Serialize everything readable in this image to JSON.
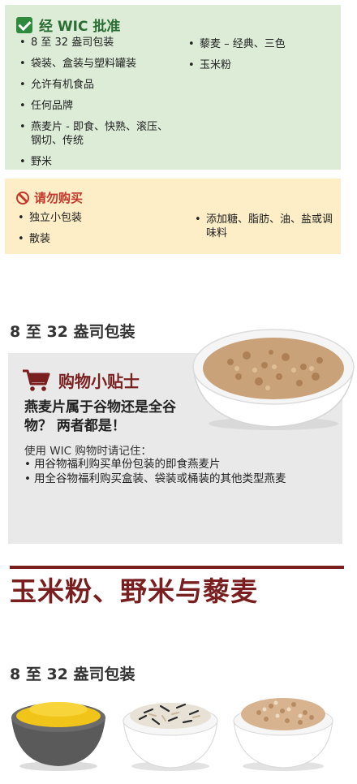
{
  "approved": {
    "title": "经 WIC 批准",
    "col1": [
      "8 至 32 盎司包装",
      "袋装、盒装与塑料罐装",
      "允许有机食品",
      "任何品牌",
      "燕麦片 - 即食、快熟、滚压、钢切、传统",
      "野米"
    ],
    "col2": [
      "藜麦 – 经典、三色",
      "玉米粉"
    ]
  },
  "not_buy": {
    "title": "请勿购买",
    "col1": [
      "独立小包装",
      "散装"
    ],
    "col2": [
      "添加糖、脂肪、油、盐或调味料"
    ]
  },
  "oats_section": {
    "size": "8 至 32 盎司包装"
  },
  "tips": {
    "title": "购物小贴士",
    "question": "燕麦片属于谷物还是全谷物？ 两者都是！",
    "intro": "使用 WIC 购物时请记住：",
    "items": [
      "用谷物福利购买单份包装的即食燕麦片",
      "用全谷物福利购买盒装、袋装或桶装的其他类型燕麦"
    ]
  },
  "cornmeal_section": {
    "heading": "玉米粉、野米与藜麦",
    "size": "8 至 32 盎司包装"
  },
  "colors": {
    "green": "#2e8b3e",
    "red": "#c0392b",
    "maroon": "#7a1f1f",
    "approved_bg": "#dcecd7",
    "notbuy_bg": "#fdeec7"
  }
}
